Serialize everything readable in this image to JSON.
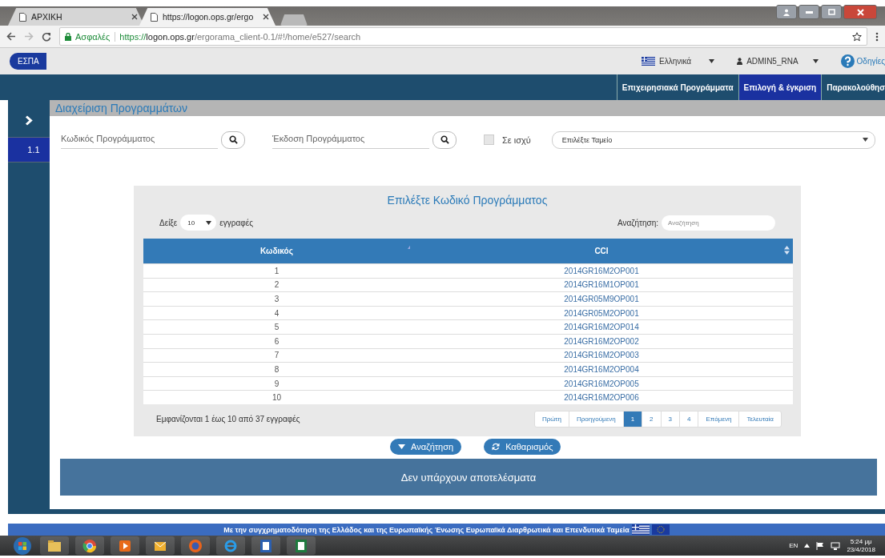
{
  "browser": {
    "tabs": [
      {
        "label": "ΑΡΧΙΚΗ",
        "selected": false
      },
      {
        "label": "https://logon.ops.gr/ergo",
        "selected": true
      }
    ],
    "secure_label": "Ασφαλές",
    "url_scheme": "https://",
    "url_host": "logon.ops.gr",
    "url_path": "/ergorama_client-0.1/#!/home/e527/search"
  },
  "header": {
    "logo": "ΕΣΠΑ",
    "language": "Ελληνικά",
    "user": "ADMIN5_RNA",
    "help": "Οδηγίες"
  },
  "nav": [
    {
      "label": "Επιχειρησιακά Προγράμματα",
      "selected": false
    },
    {
      "label": "Επιλογή & έγκριση",
      "selected": true
    },
    {
      "label": "Παρακολούθησ",
      "selected": false
    }
  ],
  "sidebar": {
    "items": [
      {
        "label": "1.1",
        "selected": true
      }
    ]
  },
  "page_title": "Διαχείριση Προγραμμάτων",
  "filters": {
    "program_code": {
      "placeholder": "Κωδικός Προγράμματος"
    },
    "program_version": {
      "placeholder": "Έκδοση Προγράμματος"
    },
    "in_force": {
      "label": "Σε ισχύ",
      "checked": false
    },
    "fund": {
      "value": "Επιλέξτε Ταμείο"
    }
  },
  "table_panel": {
    "title": "Επιλέξτε Κωδικό Προγράμματος",
    "show_label": "Δείξε",
    "page_size": "10",
    "entries_label": "εγγραφές",
    "search_label": "Αναζήτηση:",
    "search": {
      "placeholder": "Αναζήτηση"
    },
    "columns": [
      "Κωδικός",
      "CCI"
    ],
    "rows": [
      [
        "1",
        "2014GR16M2OP001"
      ],
      [
        "2",
        "2014GR16M1OP001"
      ],
      [
        "3",
        "2014GR05M9OP001"
      ],
      [
        "4",
        "2014GR05M2OP001"
      ],
      [
        "5",
        "2014GR16M2OP014"
      ],
      [
        "6",
        "2014GR16M2OP002"
      ],
      [
        "7",
        "2014GR16M2OP003"
      ],
      [
        "8",
        "2014GR16M2OP004"
      ],
      [
        "9",
        "2014GR16M2OP005"
      ],
      [
        "10",
        "2014GR16M2OP006"
      ]
    ],
    "info": "Εμφανίζονται 1 έως 10 από 37 εγγραφές",
    "pagination": [
      {
        "label": "Πρώτη",
        "selected": false
      },
      {
        "label": "Προηγούμενη",
        "selected": false
      },
      {
        "label": "1",
        "selected": true
      },
      {
        "label": "2",
        "selected": false
      },
      {
        "label": "3",
        "selected": false
      },
      {
        "label": "4",
        "selected": false
      },
      {
        "label": "Επόμενη",
        "selected": false
      },
      {
        "label": "Τελευταία",
        "selected": false
      }
    ]
  },
  "buttons": [
    {
      "label": "Αναζήτηση",
      "kind": "search"
    },
    {
      "label": "Καθαρισμός",
      "kind": "clear"
    }
  ],
  "result_message": "Δεν υπάρχουν αποτελέσματα",
  "footer": "Με την συγχρηματοδότηση της Ελλάδος και της Ευρωπαϊκής Ένωσης Ευρωπαϊκά Διαρθρωτικά και Επενδυτικά Ταμεία",
  "taskbar": {
    "language": "EN",
    "time": "5:24 μμ",
    "date": "23/4/2018"
  }
}
